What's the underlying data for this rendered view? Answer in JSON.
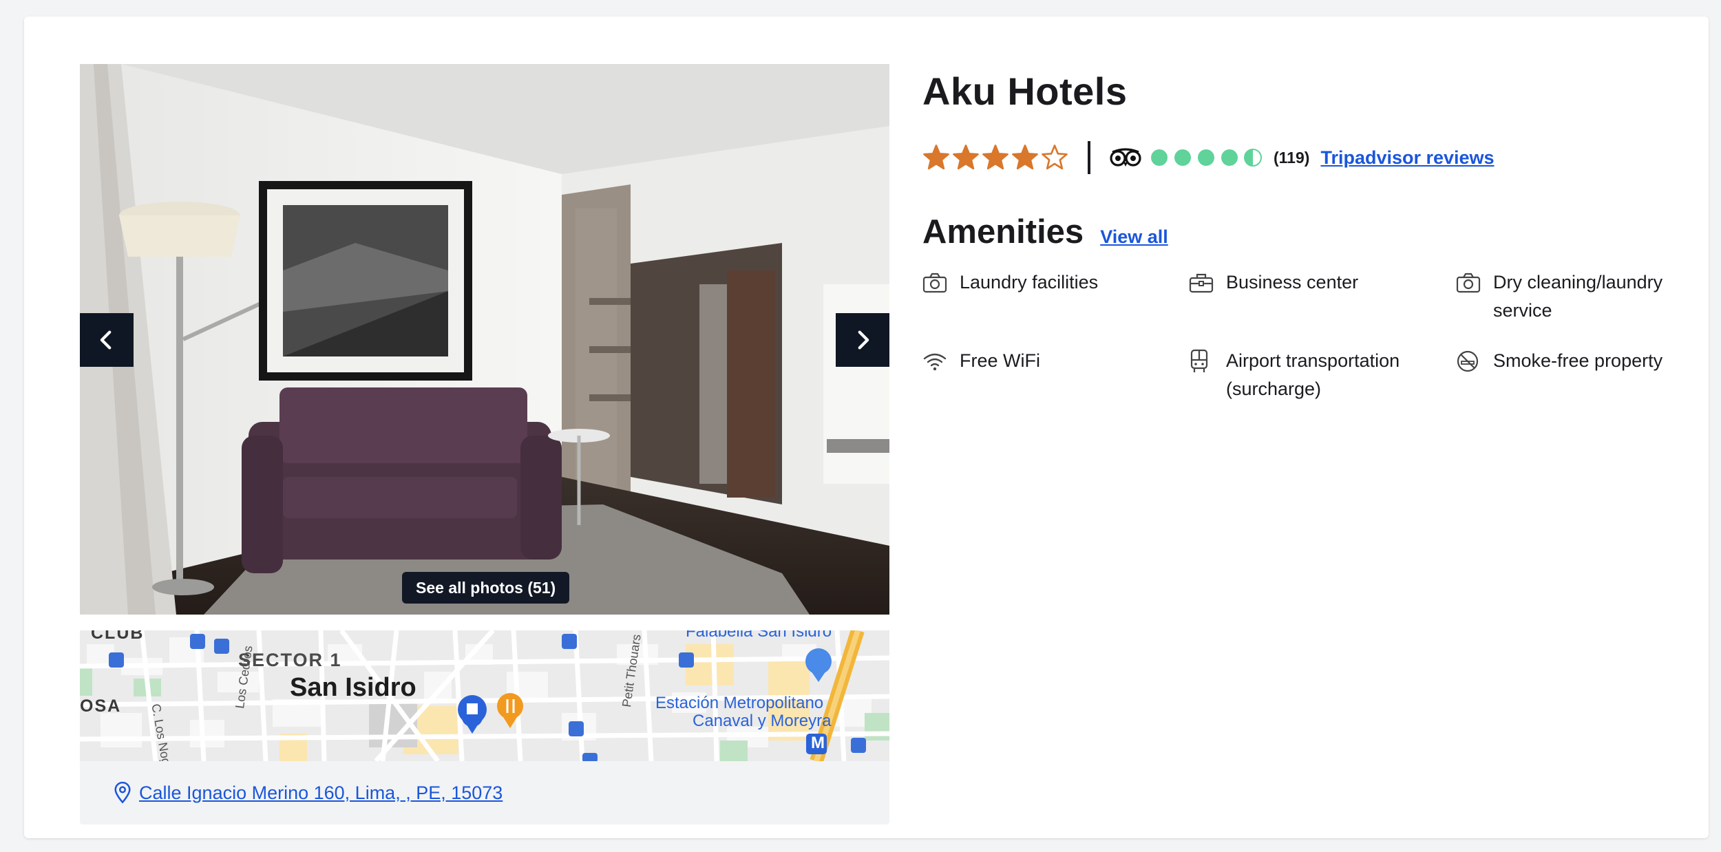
{
  "hotel": {
    "name": "Aku Hotels",
    "star_rating": 4,
    "star_max": 5
  },
  "tripadvisor": {
    "rating": 4.5,
    "rating_max": 5,
    "review_count": "(119)",
    "link_label": "Tripadvisor reviews"
  },
  "gallery": {
    "see_all_label": "See all photos (51)",
    "prev_icon": "chevron-left-icon",
    "next_icon": "chevron-right-icon"
  },
  "map": {
    "labels": {
      "club": "CLUB",
      "sector": "SECTOR 1",
      "district": "San Isidro",
      "osa": "OSA",
      "los_nogales": "C. Los Nogales",
      "los_cedros": "Los Cedros",
      "petit_thouars": "Petit Thouars",
      "falabella": "Falabella San Isidro",
      "station_line1": "Estación Metropolitano",
      "station_line2": "Canaval y Moreyra",
      "metro": "M"
    }
  },
  "address": {
    "text": "Calle Ignacio Merino 160, Lima, , PE, 15073",
    "icon": "map-pin-icon"
  },
  "amenities": {
    "heading": "Amenities",
    "view_all_label": "View all",
    "items": [
      {
        "label": "Laundry facilities",
        "icon": "camera-icon"
      },
      {
        "label": "Business center",
        "icon": "briefcase-icon"
      },
      {
        "label": "Dry cleaning/laundry service",
        "icon": "camera-icon"
      },
      {
        "label": "Free WiFi",
        "icon": "wifi-icon"
      },
      {
        "label": "Airport transportation (surcharge)",
        "icon": "bus-icon"
      },
      {
        "label": "Smoke-free property",
        "icon": "no-smoking-icon"
      }
    ]
  },
  "colors": {
    "link": "#1a56db",
    "star": "#d9772b",
    "bubble": "#5fd39a",
    "dark_button": "#0f1724"
  }
}
